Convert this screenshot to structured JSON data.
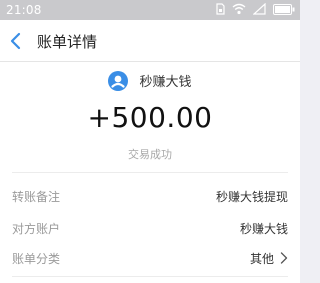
{
  "status_bar": {
    "time": "21:08",
    "icons": [
      "sim-icon",
      "wifi-icon",
      "signal-icon",
      "battery-icon"
    ]
  },
  "nav": {
    "back_icon": "chevron-left-icon",
    "title": "账单详情",
    "accent_color": "#3a8ee6"
  },
  "transaction": {
    "payee": "秒赚大钱",
    "avatar_icon": "user-avatar-icon",
    "amount": "+500.00",
    "status": "交易成功"
  },
  "details": [
    {
      "label": "转账备注",
      "value": "秒赚大钱提现"
    },
    {
      "label": "对方账户",
      "value": "秒赚大钱"
    },
    {
      "label": "账单分类",
      "value": "其他",
      "icon": "chevron-right-icon"
    }
  ]
}
